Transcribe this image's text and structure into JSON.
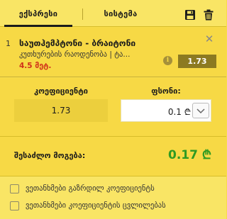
{
  "tabs": [
    {
      "label": "ექსპრესი",
      "active": true
    },
    {
      "label": "სისტემა",
      "active": false
    }
  ],
  "toolbar": {
    "save_icon": "save-icon",
    "delete_icon": "trash-icon"
  },
  "bet": {
    "index": "1",
    "event": "საუთჰემპტონი - ბრაიტონი",
    "market": "კუთხურების რაოდენობა | ტა...",
    "stake": "4.5 მეტ.",
    "odds": "1.73",
    "info_icon": "i"
  },
  "calc": {
    "coef_label": "კოეფიციენტი",
    "coef_value": "1.73",
    "amount_label": "ფსონი:",
    "amount_value": "0.1 ₾",
    "win_label": "შესაძლო მოგება:",
    "win_value": "0.17 ₾"
  },
  "options": [
    {
      "label": "ვეთანხმები გაზრდილ კოეფიციენტს",
      "checked": false
    },
    {
      "label": "ვეთანხმები კოეფიციენტის ცვლილებას",
      "checked": false
    }
  ],
  "colors": {
    "background": "#f7dc4a",
    "odds_badge": "#8c7a21",
    "stake_text": "#d0301a",
    "win_value": "#2f9a22"
  }
}
